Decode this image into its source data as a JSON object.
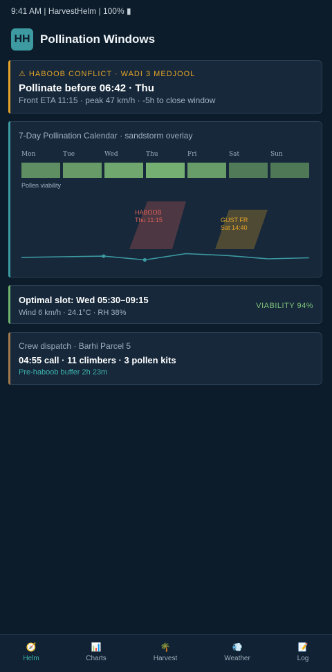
{
  "status_bar": {
    "text": "9:41 AM | HarvestHelm | 100% ▮"
  },
  "header": {
    "logo_text": "HH",
    "title": "Pollination Windows"
  },
  "alert": {
    "kicker": "⚠ HABOOB CONFLICT · WADI 3 MEDJOOL",
    "headline": "Pollinate before 06:42 · Thu",
    "subtitle": "Front ETA 11:15 · peak 47 km/h · -5h to close window",
    "accent": "#e5a429"
  },
  "calendar": {
    "title": "7-Day Pollination Calendar · sandstorm overlay",
    "days": [
      "Mon",
      "Tue",
      "Wed",
      "Thu",
      "Fri",
      "Sat",
      "Sun"
    ],
    "viability_label": "Pollen viability",
    "overlays": [
      {
        "line1": "HABOOB",
        "line2": "Thu 11:15",
        "color": "#e0625a"
      },
      {
        "line1": "GUST FR",
        "line2": "Sat 14:40",
        "color": "#e5a429"
      }
    ],
    "accent": "#3d9aa1"
  },
  "chart_data": {
    "type": "heatmap",
    "categories": [
      "Mon",
      "Tue",
      "Wed",
      "Thu",
      "Fri",
      "Sat",
      "Sun"
    ],
    "viability_level": [
      0.55,
      0.68,
      0.82,
      0.9,
      0.7,
      0.35,
      0.32
    ],
    "trend_line": {
      "values": [
        0.47,
        0.5,
        0.53,
        0.35,
        0.65,
        0.56,
        0.4,
        0.45
      ],
      "markers": [
        "Wed",
        "Thu"
      ]
    }
  },
  "optimal": {
    "title": "Optimal slot: Wed 05:30–09:15",
    "subtitle": "Wind 6 km/h · 24.1°C · RH 38%",
    "viability": "VIABILITY 94%",
    "accent": "#6fb36e"
  },
  "crew": {
    "title": "Crew dispatch · Barhi Parcel 5",
    "main": "04:55 call · 11 climbers · 3 pollen kits",
    "buffer": "Pre-haboob buffer 2h 23m",
    "accent": "#a07a4e"
  },
  "nav": {
    "items": [
      {
        "label": "Helm",
        "icon": "🧭",
        "icon_name": "compass-icon",
        "active": true
      },
      {
        "label": "Charts",
        "icon": "📊",
        "icon_name": "bar-chart-icon",
        "active": false
      },
      {
        "label": "Harvest",
        "icon": "🌴",
        "icon_name": "palm-tree-icon",
        "active": false
      },
      {
        "label": "Weather",
        "icon": "💨",
        "icon_name": "wind-icon",
        "active": false
      },
      {
        "label": "Log",
        "icon": "📝",
        "icon_name": "memo-icon",
        "active": false
      }
    ]
  }
}
